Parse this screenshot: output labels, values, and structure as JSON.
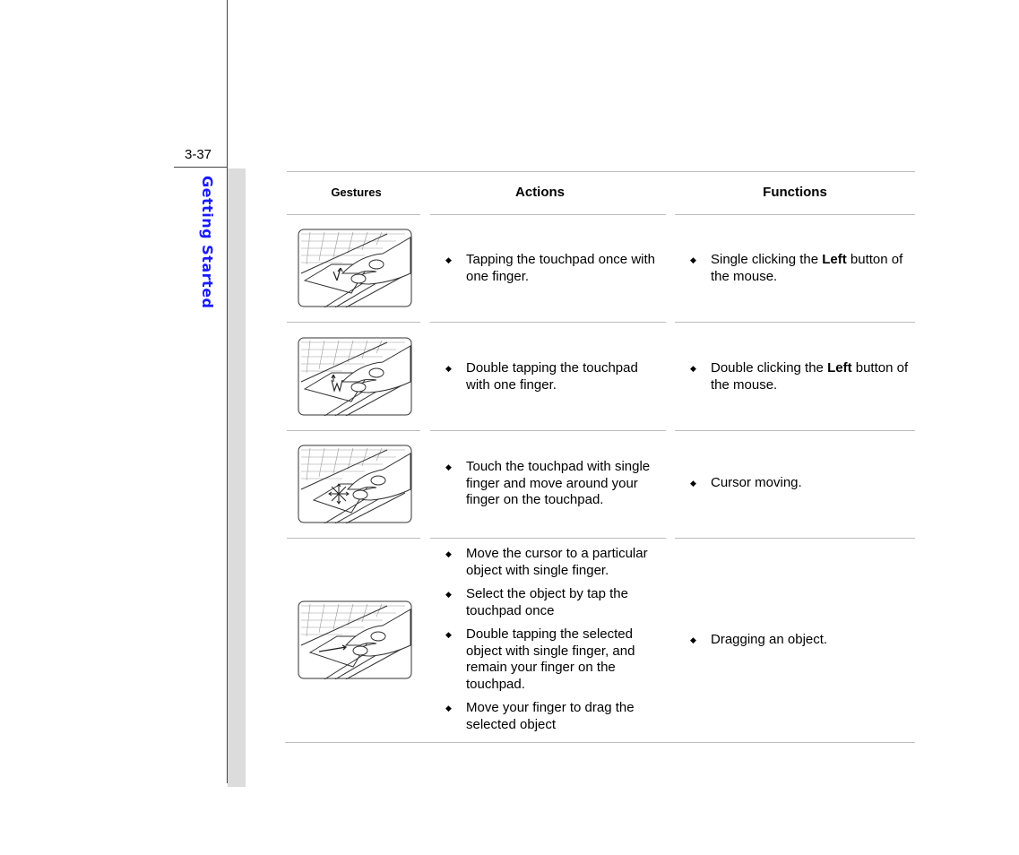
{
  "page": {
    "number": "3-37",
    "section_title": "Getting Started",
    "section_title_color": "#1a1aff"
  },
  "table": {
    "headers": {
      "gestures": "Gestures",
      "actions": "Actions",
      "functions": "Functions"
    },
    "rows": [
      {
        "gesture_icon": "touchpad-single-tap-icon",
        "actions": [
          "Tapping the touchpad once with one finger."
        ],
        "functions": [
          {
            "pre": "Single clicking the ",
            "bold": "Left",
            "post": " button of the mouse."
          }
        ]
      },
      {
        "gesture_icon": "touchpad-double-tap-icon",
        "actions": [
          "Double tapping the touchpad with one finger."
        ],
        "functions": [
          {
            "pre": "Double clicking the ",
            "bold": "Left",
            "post": " button of the mouse."
          }
        ]
      },
      {
        "gesture_icon": "touchpad-move-cursor-icon",
        "actions": [
          "Touch the touchpad with single finger and move around your finger on the touchpad."
        ],
        "functions": [
          {
            "pre": "Cursor moving.",
            "bold": "",
            "post": ""
          }
        ]
      },
      {
        "gesture_icon": "touchpad-drag-icon",
        "actions": [
          "Move the cursor to a particular object with single finger.",
          "Select the object by tap the touchpad once",
          "Double tapping the selected object with single finger, and remain your finger on the touchpad.",
          "Move your finger to drag the selected object"
        ],
        "functions": [
          {
            "pre": "Dragging an object.",
            "bold": "",
            "post": ""
          }
        ]
      }
    ],
    "bullet_glyph": "◆"
  }
}
